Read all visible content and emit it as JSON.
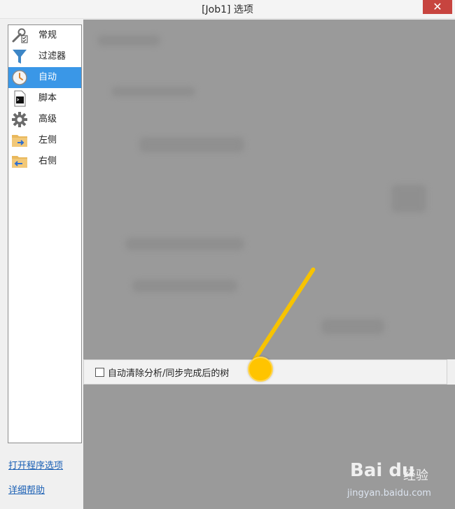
{
  "window": {
    "title": "[Job1] 选项",
    "close_symbol": "✕"
  },
  "nav": {
    "items": [
      {
        "label": "常规",
        "icon": "wrench-checklist-icon",
        "selected": false
      },
      {
        "label": "过滤器",
        "icon": "filter-funnel-icon",
        "selected": false
      },
      {
        "label": "自动",
        "icon": "clock-icon",
        "selected": true
      },
      {
        "label": "脚本",
        "icon": "script-terminal-icon",
        "selected": false
      },
      {
        "label": "高级",
        "icon": "gear-icon",
        "selected": false
      },
      {
        "label": "左侧",
        "icon": "folder-right-arrow-icon",
        "selected": false
      },
      {
        "label": "右侧",
        "icon": "folder-left-arrow-icon",
        "selected": false
      }
    ]
  },
  "links": {
    "open_program_options": "打开程序选项",
    "detailed_help": "详细帮助"
  },
  "content": {
    "auto_clear_checkbox_label": "自动清除分析/同步完成后的树",
    "auto_clear_checked": false
  },
  "watermark": {
    "logo": "Bai du",
    "cn": "经验",
    "url": "jingyan.baidu.com"
  },
  "colors": {
    "selected_bg": "#3a97e7",
    "close_red": "#c7443f",
    "pointer_yellow": "#ffc400",
    "blur_gray": "#9a9a9a"
  }
}
